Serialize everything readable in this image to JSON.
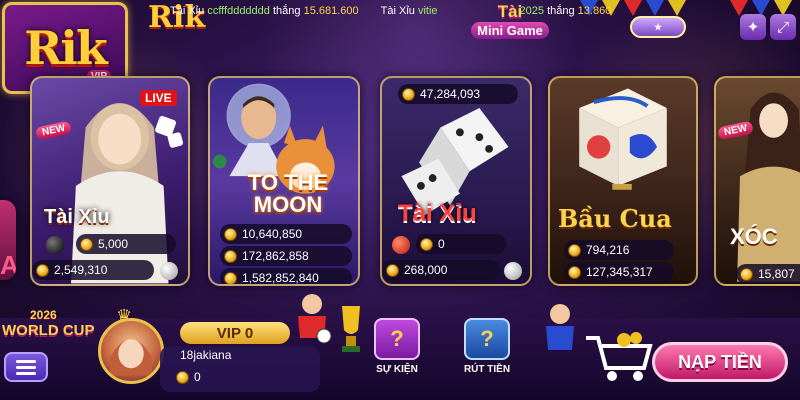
{
  "ticker": [
    {
      "game": "Tài Xỉu",
      "user": "ccfffddddddd",
      "verb": "thắng",
      "amount": "15.681.600"
    },
    {
      "game": "Tài Xỉu",
      "user": "vitie",
      "verb": "",
      "amount": ""
    },
    {
      "game": "",
      "user": "2025",
      "verb": "thắng",
      "amount": "13.860"
    }
  ],
  "logo": {
    "text": "Rik",
    "sub": "VIP",
    "small_text": "Rik"
  },
  "mini_game": {
    "line1": "Tài",
    "line2": "Mini Game"
  },
  "top_icons": [
    "event-icon",
    "puzzle-icon",
    "fullscreen-icon"
  ],
  "game_cards": [
    {
      "name": "Tài Xỉu",
      "badge_new": "NEW",
      "badge_live": "LIVE",
      "rows": [
        "5,000",
        "2,549,310"
      ]
    },
    {
      "name": "TO THE MOON",
      "rows": [
        "10,640,850",
        "172,862,858",
        "1,582,852,840"
      ]
    },
    {
      "name": "Tài Xỉu",
      "jackpot": "47,284,093",
      "rows": [
        "0",
        "268,000"
      ]
    },
    {
      "name": "Bầu Cua",
      "rows": [
        "794,216",
        "127,345,317"
      ]
    },
    {
      "name": "XÓC",
      "badge_new": "NEW",
      "rows": [
        "15,807"
      ]
    }
  ],
  "world_cup": {
    "year": "2026",
    "label": "WORLD CUP"
  },
  "player": {
    "vip": "VIP 0",
    "username": "18jakiana",
    "balance": "0"
  },
  "actions": [
    {
      "label": "SỰ KIỆN",
      "icon": "gift-box-icon"
    },
    {
      "label": "RÚT TIỀN",
      "icon": "withdraw-card-icon"
    }
  ],
  "deposit_button": "NẠP TIỀN",
  "colors": {
    "accent_gold": "#ffcf3a",
    "accent_pink": "#e0186a",
    "bg_purple": "#2a1248"
  }
}
